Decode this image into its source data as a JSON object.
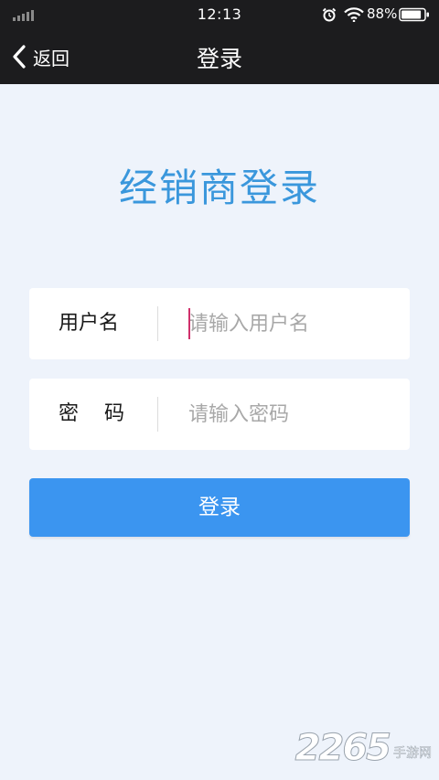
{
  "status_bar": {
    "time": "12:13",
    "battery_percent": "88%",
    "battery_level": 0.88,
    "icons": [
      "signal-icon",
      "alarm-icon",
      "wifi-icon",
      "battery-icon"
    ]
  },
  "nav": {
    "back_label": "返回",
    "title": "登录"
  },
  "main": {
    "title": "经销商登录"
  },
  "form": {
    "username_label": "用户名",
    "username_placeholder": "请输入用户名",
    "password_label": "密    码",
    "password_placeholder": "请输入密码",
    "submit_label": "登录"
  },
  "watermark": {
    "digits": "2265",
    "text": "手游网"
  },
  "colors": {
    "topbar": "#1c1c1e",
    "background": "#eef3fb",
    "accent_title": "#3a97dc",
    "button": "#3b95f0",
    "caret": "#d0306b"
  }
}
